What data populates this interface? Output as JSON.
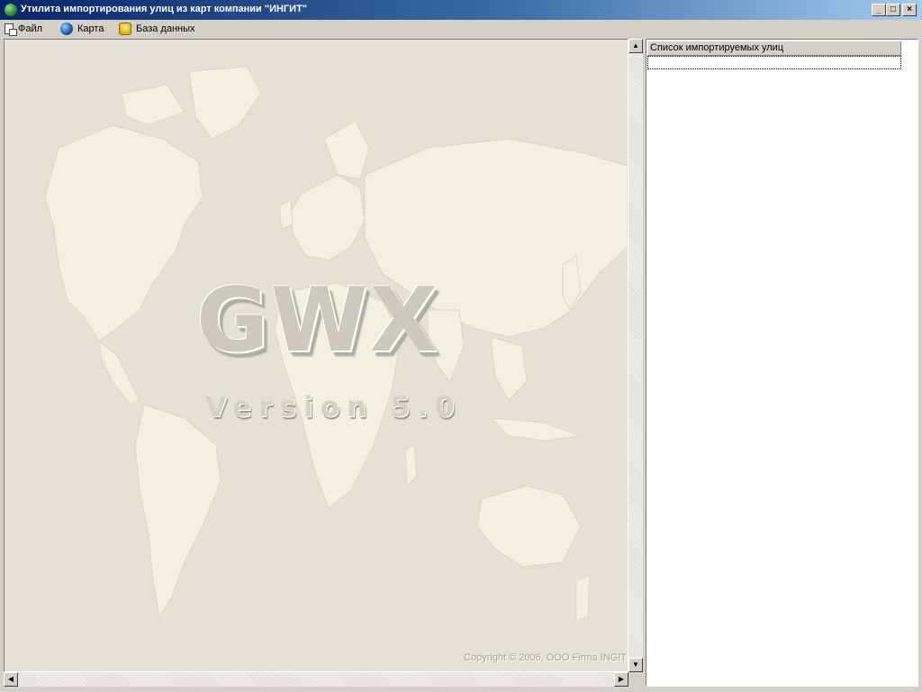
{
  "window": {
    "title": "Утилита импортирования улиц из карт компании \"ИНГИТ\"",
    "controls": {
      "minimize": "_",
      "maximize": "□",
      "close": "×"
    }
  },
  "menu": {
    "items": [
      {
        "label": "Файл",
        "icon": "file-icon"
      },
      {
        "label": "Карта",
        "icon": "globe-icon"
      },
      {
        "label": "База данных",
        "icon": "database-icon"
      }
    ]
  },
  "map_panel": {
    "logo": "GWX",
    "version": "Version 5.0",
    "copyright": "Copyright © 2006, OOO Firma INGIT"
  },
  "scrollbars": {
    "up_arrow": "▲",
    "down_arrow": "▼",
    "left_arrow": "◀",
    "right_arrow": "▶"
  },
  "street_list": {
    "header": "Список импортируемых улиц",
    "rows": []
  },
  "colors": {
    "title_gradient_start": "#0a246a",
    "title_gradient_end": "#a6caf0",
    "map_background": "#e8e3d9",
    "land": "#f2eedf"
  }
}
